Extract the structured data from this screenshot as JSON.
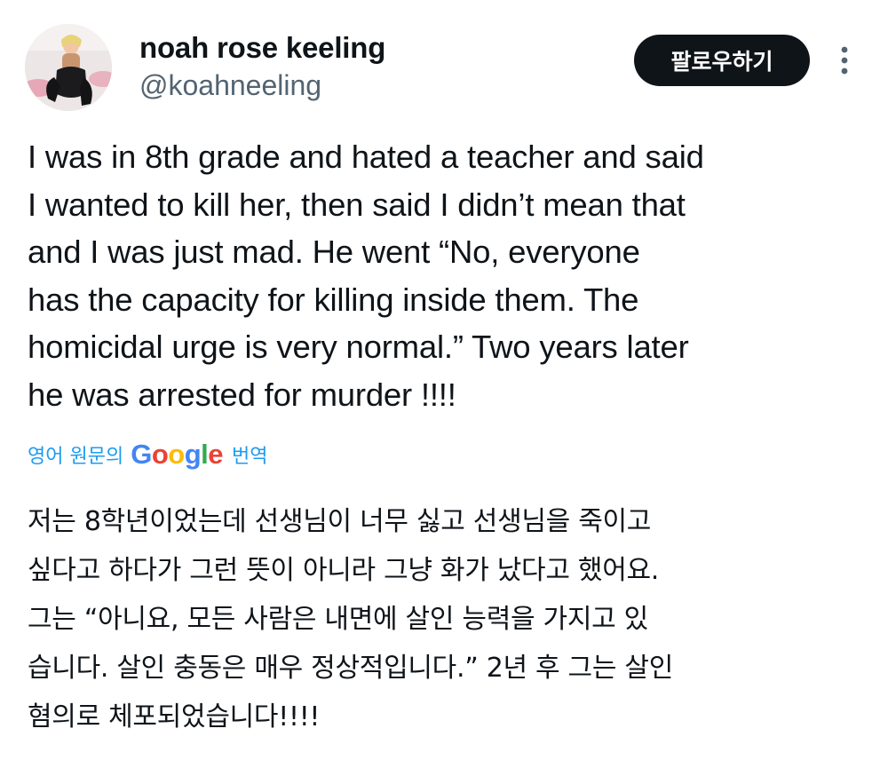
{
  "user": {
    "display_name": "noah rose keeling",
    "handle": "@koahneeling"
  },
  "header": {
    "follow_label": "팔로우하기",
    "more_icon": "more-vertical-icon"
  },
  "tweet": {
    "text": "I was in 8th grade and hated a teacher and said\nI wanted to kill her, then said I didn’t mean that\nand I was just mad.  He went “No, everyone\nhas the capacity for killing inside them.  The\nhomicidal urge is very normal.”  Two years later\nhe was arrested for murder !!!!"
  },
  "translation": {
    "prefix": "영어 원문의",
    "logo_letters": [
      "G",
      "o",
      "o",
      "g",
      "l",
      "e"
    ],
    "suffix": "번역",
    "text": "저는 8학년이었는데 선생님이 너무 싫고 선생님을 죽이고\n싶다고 하다가 그런 뜻이 아니라 그냥 화가 났다고 했어요.\n그는 “아니요, 모든 사람은 내면에 살인 능력을 가지고 있\n습니다. 살인 충동은 매우 정상적입니다.” 2년 후 그는 살인\n혐의로 체포되었습니다!!!!"
  },
  "colors": {
    "accent": "#1d9bf0",
    "text": "#0f1419",
    "secondary": "#536471",
    "button_bg": "#0f1419",
    "google": [
      "#4285F4",
      "#EA4335",
      "#FBBC05",
      "#4285F4",
      "#34A853",
      "#EA4335"
    ]
  }
}
